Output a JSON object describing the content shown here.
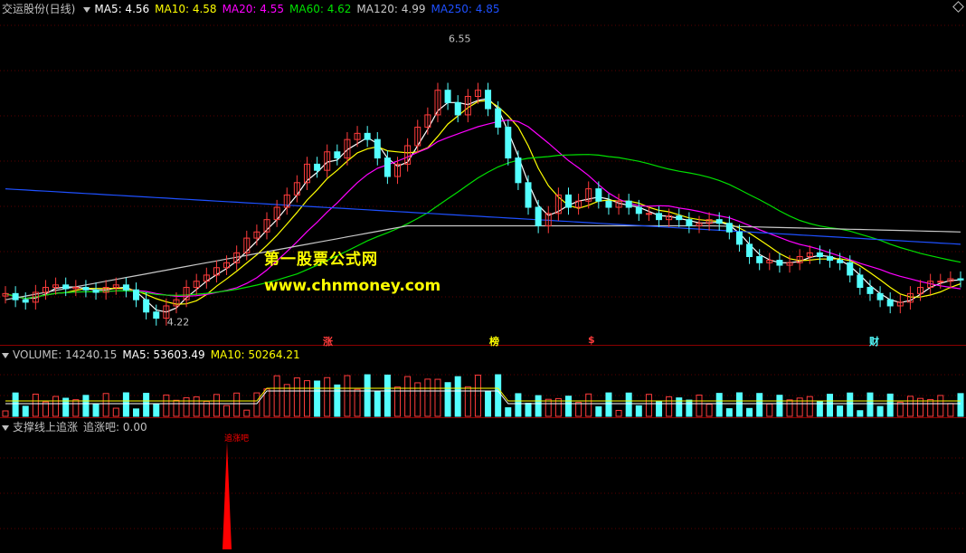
{
  "header": {
    "stock_name": "交运股份(日线)",
    "ma5": "MA5: 4.56",
    "ma10": "MA10: 4.58",
    "ma20": "MA20: 4.55",
    "ma60": "MA60: 4.62",
    "ma120": "MA120: 4.99",
    "ma250": "MA250: 4.85"
  },
  "volume_header": {
    "volume": "VOLUME: 14240.15",
    "ma5": "MA5: 53603.49",
    "ma10": "MA10: 50264.21"
  },
  "indicator_header": {
    "name": "支撑线上追涨",
    "value": "追涨吧: 0.00"
  },
  "watermark": {
    "line1": "第一股票公式网",
    "line2": "www.chnmoney.com"
  },
  "event_markers": [
    "涨",
    "榜",
    "$",
    "财"
  ],
  "colors": {
    "up": "#ff3c3c",
    "down": "#54ffff",
    "ma5": "#ffffff",
    "ma10": "#ffff00",
    "ma20": "#ff00ff",
    "ma60": "#00e000",
    "ma120": "#c8c8c8",
    "ma250": "#1e50ff",
    "indicator": "#ff0000"
  },
  "chart_data": [
    {
      "type": "candlestick",
      "title": "交运股份(日线)",
      "ylim": [
        4.1,
        6.7
      ],
      "price_labels": {
        "high": "6.55",
        "low": "4.22"
      },
      "series": [
        {
          "name": "MA5",
          "value": 4.56
        },
        {
          "name": "MA10",
          "value": 4.58
        },
        {
          "name": "MA20",
          "value": 4.55
        },
        {
          "name": "MA60",
          "value": 4.62
        },
        {
          "name": "MA120",
          "value": 4.99
        },
        {
          "name": "MA250",
          "value": 4.85
        }
      ],
      "closes": [
        4.45,
        4.4,
        4.38,
        4.46,
        4.5,
        4.52,
        4.49,
        4.5,
        4.48,
        4.46,
        4.5,
        4.52,
        4.48,
        4.4,
        4.3,
        4.25,
        4.35,
        4.4,
        4.5,
        4.55,
        4.6,
        4.66,
        4.7,
        4.78,
        4.9,
        4.95,
        5.05,
        5.15,
        5.25,
        5.35,
        5.5,
        5.45,
        5.6,
        5.55,
        5.7,
        5.75,
        5.7,
        5.55,
        5.4,
        5.5,
        5.65,
        5.8,
        5.9,
        6.1,
        6.0,
        5.9,
        6.05,
        6.1,
        5.95,
        5.8,
        5.55,
        5.35,
        5.15,
        5.0,
        5.1,
        5.25,
        5.15,
        5.2,
        5.3,
        5.2,
        5.15,
        5.2,
        5.15,
        5.1,
        5.1,
        5.05,
        5.08,
        5.05,
        5.0,
        5.02,
        5.05,
        5.02,
        4.95,
        4.85,
        4.75,
        4.7,
        4.72,
        4.68,
        4.7,
        4.75,
        4.78,
        4.75,
        4.72,
        4.7,
        4.6,
        4.5,
        4.45,
        4.4,
        4.35,
        4.38,
        4.45,
        4.5,
        4.55,
        4.55,
        4.57,
        4.56
      ]
    },
    {
      "type": "bar",
      "title": "VOLUME",
      "series": [
        {
          "name": "VOLUME",
          "value": 14240.15
        },
        {
          "name": "MA5",
          "value": 53603.49
        },
        {
          "name": "MA10",
          "value": 50264.21
        }
      ]
    },
    {
      "type": "bar",
      "title": "支撑线上追涨",
      "series": [
        {
          "name": "追涨吧",
          "value": 0.0
        }
      ],
      "spike_label": "追涨吧"
    }
  ]
}
